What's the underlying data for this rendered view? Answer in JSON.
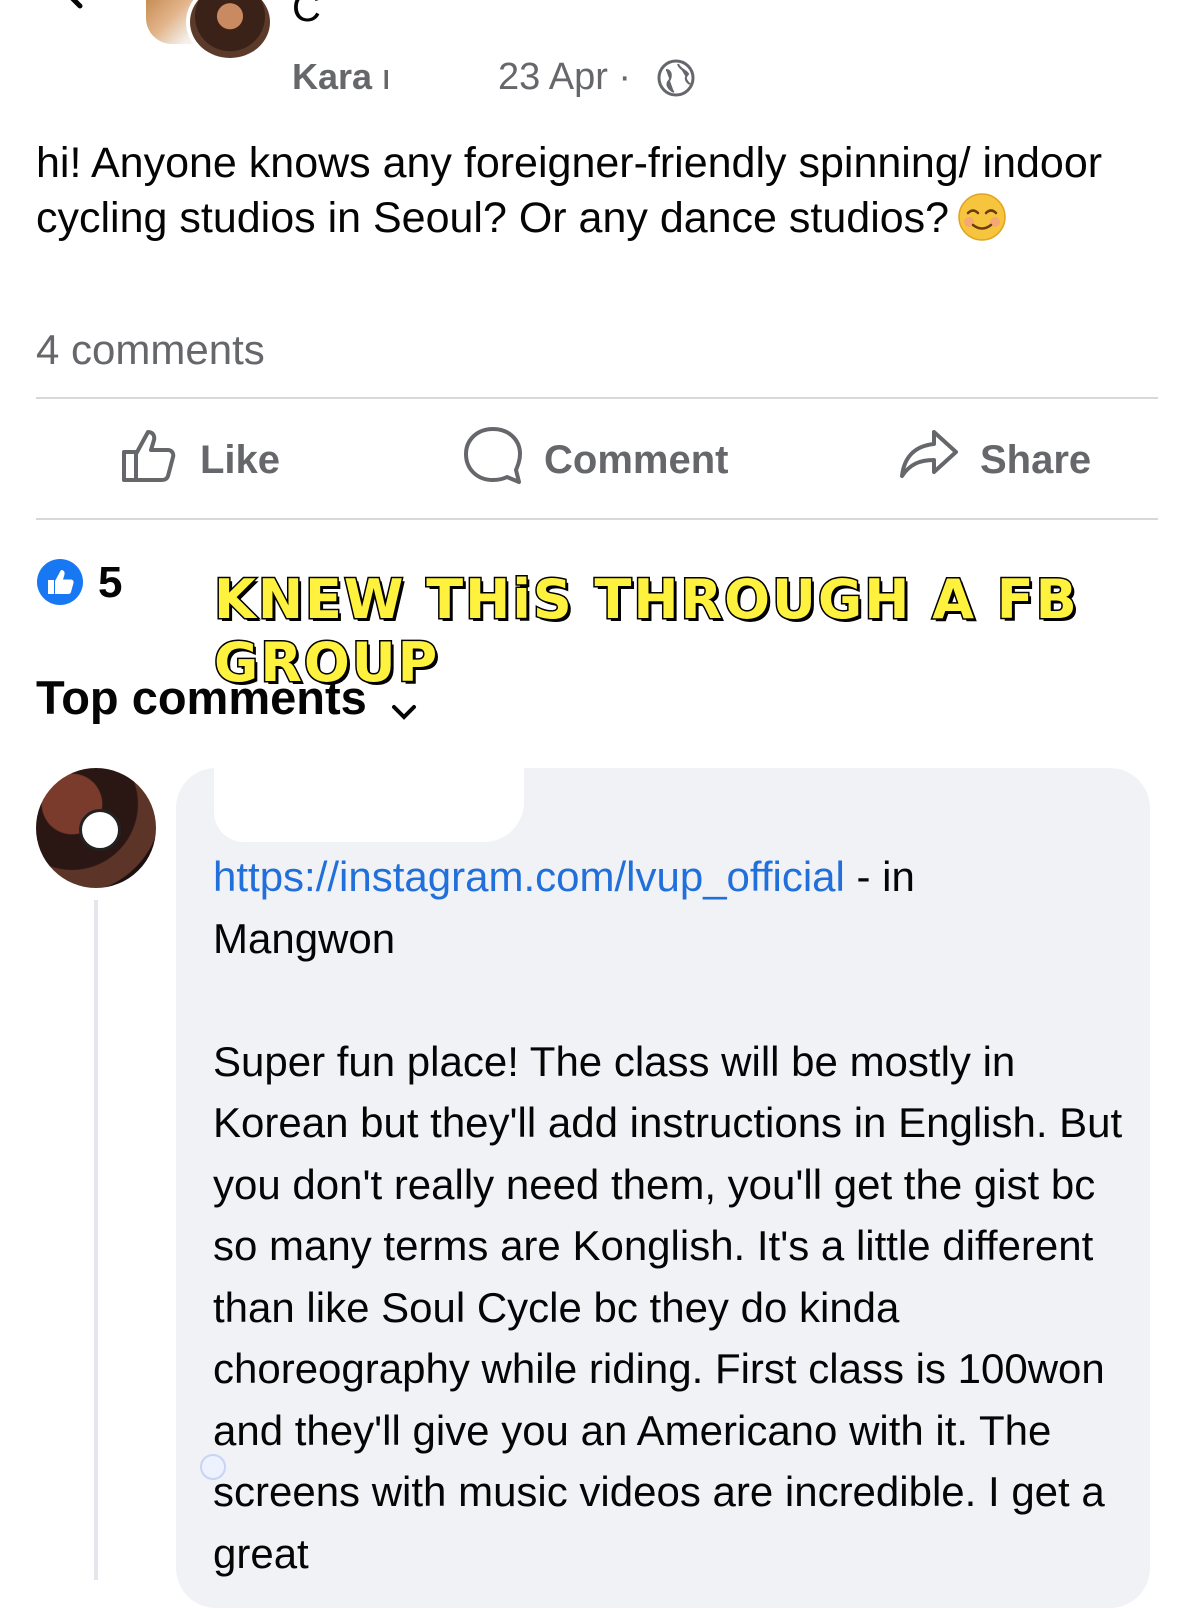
{
  "post": {
    "group_name": "C",
    "author": "Kara r",
    "date": "23 Apr ·",
    "text": "hi! Anyone knows any foreigner-friendly spinning/ indoor cycling studios in Seoul? Or any dance studios?",
    "comment_count": "4 comments"
  },
  "actions": {
    "like": "Like",
    "comment": "Comment",
    "share": "Share"
  },
  "reactions": {
    "count": "5"
  },
  "overlay_caption": "KNEW THiS THROUGH A FB GROUP",
  "top_comments": {
    "label": "Top comments"
  },
  "comment": {
    "link": "https://instagram.com/lvup_official",
    "link_suffix": " - in\nMangwon\n\n",
    "text": "Super fun place! The class will be mostly in Korean but they'll add instructions in English. But you don't really need them, you'll get the gist bc so many terms are Konglish. It's a little different than like Soul Cycle bc they do kinda choreography while riding. First class is 100won and they'll give you an Americano with it. The screens with music videos are incredible. I get a great"
  },
  "colors": {
    "text": "#050505",
    "secondary_text": "#65676b",
    "link": "#216fdb",
    "like_blue": "#1877f2",
    "bubble_bg": "#f0f2f5",
    "caption_yellow": "#fff23e"
  },
  "icons": [
    "back-arrow-icon",
    "globe-icon",
    "smiling-emoji-icon",
    "thumbs-up-icon",
    "comment-bubble-icon",
    "share-arrow-icon",
    "like-reaction-icon",
    "chevron-down-icon"
  ]
}
